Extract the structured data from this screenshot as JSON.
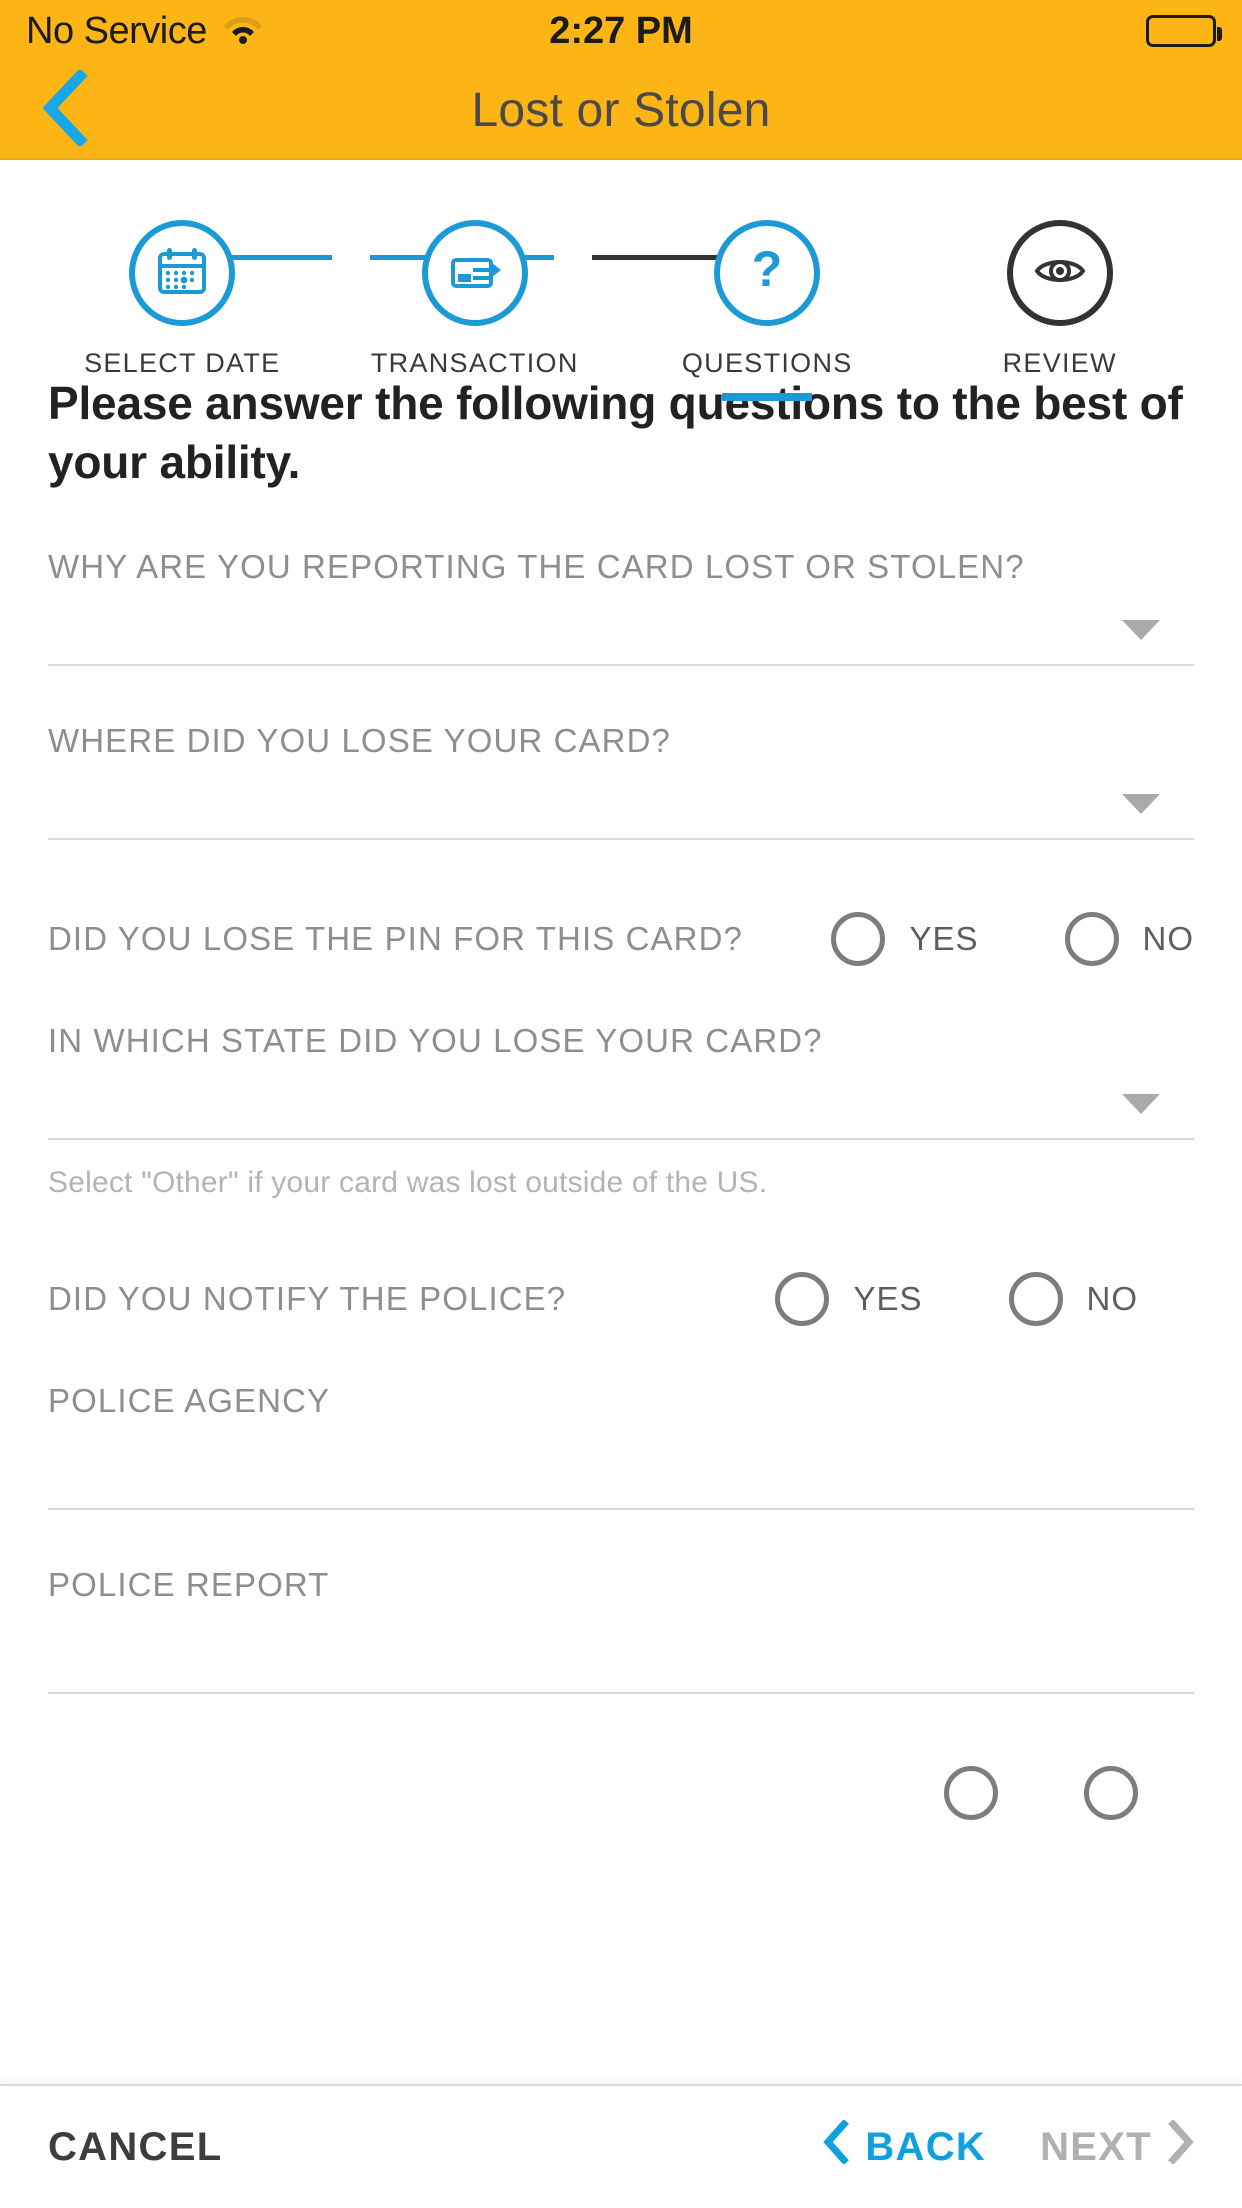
{
  "status_bar": {
    "carrier": "No Service",
    "wifi_icon": "wifi-icon",
    "time": "2:27 PM",
    "battery_icon": "battery-full-icon"
  },
  "nav": {
    "back_icon": "chevron-left-icon",
    "title": "Lost or Stolen"
  },
  "stepper": {
    "steps": [
      {
        "label": "SELECT DATE",
        "icon": "calendar-icon",
        "state": "complete"
      },
      {
        "label": "TRANSACTION",
        "icon": "transaction-card-icon",
        "state": "complete"
      },
      {
        "label": "QUESTIONS",
        "icon": "question-mark-icon",
        "state": "active"
      },
      {
        "label": "REVIEW",
        "icon": "eye-icon",
        "state": "inactive"
      }
    ],
    "active_color": "#1C9AD6",
    "inactive_color": "#333333"
  },
  "main": {
    "headline": "Please answer the following questions to the best of your ability.",
    "q_reason": {
      "label": "WHY ARE YOU REPORTING THE CARD LOST OR STOLEN?",
      "value": "",
      "chevron_icon": "chevron-down-icon"
    },
    "q_where": {
      "label": "WHERE DID YOU LOSE YOUR CARD?",
      "value": "",
      "chevron_icon": "chevron-down-icon"
    },
    "q_pin": {
      "label": "DID YOU LOSE THE PIN FOR THIS CARD?",
      "yes_label": "YES",
      "no_label": "NO",
      "selected": ""
    },
    "q_state": {
      "label": "IN WHICH STATE DID YOU LOSE YOUR CARD?",
      "value": "",
      "chevron_icon": "chevron-down-icon",
      "help": "Select \"Other\" if your card was lost outside of the US."
    },
    "q_police": {
      "label": "DID YOU NOTIFY THE POLICE?",
      "yes_label": "YES",
      "no_label": "NO",
      "selected": ""
    },
    "q_agency": {
      "label": "POLICE AGENCY",
      "value": ""
    },
    "q_report": {
      "label": "POLICE REPORT",
      "value": ""
    }
  },
  "bottom_bar": {
    "cancel_label": "CANCEL",
    "back_label": "BACK",
    "back_icon": "chevron-left-icon",
    "next_label": "NEXT",
    "next_icon": "chevron-right-icon",
    "back_color": "#0FA0E0",
    "next_color": "#b0b0b0"
  }
}
